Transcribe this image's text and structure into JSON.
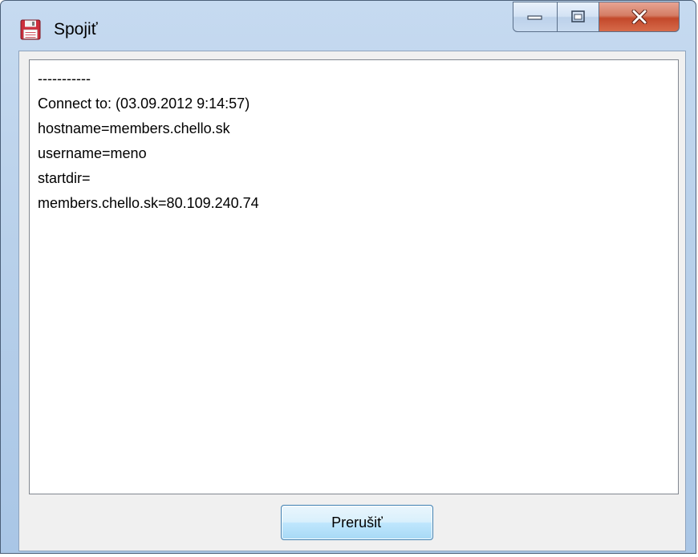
{
  "window": {
    "title": "Spojiť",
    "title_icon": "floppy-disk-icon",
    "controls": {
      "minimize_icon": "minimize-icon",
      "maximize_icon": "maximize-icon",
      "close_icon": "close-icon"
    }
  },
  "log": {
    "lines": [
      "-----------",
      "Connect to: (03.09.2012 9:14:57)",
      "hostname=members.chello.sk",
      "username=meno",
      "startdir=",
      "members.chello.sk=80.109.240.74"
    ]
  },
  "buttons": {
    "abort_label": "Prerušiť"
  },
  "colors": {
    "titlebar": "#b8d0ea",
    "close_button": "#c3492b",
    "button_border": "#3c7fb1"
  }
}
